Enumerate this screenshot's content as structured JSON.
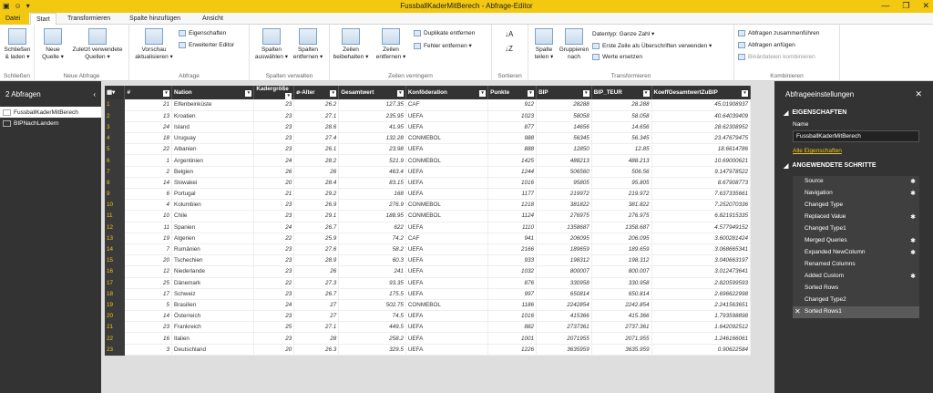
{
  "window": {
    "title": "FussballKaderMitBerech - Abfrage-Editor",
    "controls": [
      "—",
      "❐",
      "✕"
    ]
  },
  "tabs": [
    "Datei",
    "Start",
    "Transformieren",
    "Spalte hinzufügen",
    "Ansicht"
  ],
  "ribbon": {
    "schliessen": {
      "btn": "Schließen\n& laden ▾",
      "label": "Schließen"
    },
    "neue": {
      "b1": "Neue\nQuelle ▾",
      "b2": "Zuletzt verwendete\nQuellen ▾",
      "label": "Neue Abfrage"
    },
    "abfrage": {
      "b1": "Vorschau\naktualisieren ▾",
      "s1": "Eigenschaften",
      "s2": "Erweiterter Editor",
      "label": "Abfrage"
    },
    "spalten": {
      "b1": "Spalten\nauswählen ▾",
      "b2": "Spalten\nentfernen ▾",
      "label": "Spalten verwalten"
    },
    "zeilen": {
      "b1": "Zeilen\nbeibehalten ▾",
      "b2": "Zeilen\nentfernen ▾",
      "s1": "Duplikate entfernen",
      "s2": "Fehler entfernen ▾",
      "label": "Zeilen verringern"
    },
    "sort": {
      "label": "Sortieren"
    },
    "trans": {
      "b1": "Spalte\nteilen ▾",
      "b2": "Gruppieren\nnach",
      "s1": "Datentyp: Ganze Zahl ▾",
      "s2": "Erste Zeile als Überschriften verwenden ▾",
      "s3": "Werte ersetzen",
      "label": "Transformieren"
    },
    "komb": {
      "s1": "Abfragen zusammenführen",
      "s2": "Abfragen anfügen",
      "s3": "Binärdateien kombinieren",
      "label": "Kombinieren"
    }
  },
  "left": {
    "header": "2 Abfragen",
    "queries": [
      "FussballKaderMitBerech",
      "BIPNachLandern"
    ]
  },
  "grid": {
    "columns": [
      "#",
      "Nation",
      "Kadergröße",
      "ø-Alter",
      "Gesamtwert",
      "Konföderation",
      "Punkte",
      "BIP",
      "BIP_TEUR",
      "KoeffGesamtwertZuBIP"
    ],
    "rows": [
      [
        "21",
        "Elfenbeinküste",
        "23",
        "26.2",
        "127.35",
        "CAF",
        "912",
        "28288",
        "28.288",
        "45.01908937"
      ],
      [
        "13",
        "Kroatien",
        "23",
        "27.1",
        "235.95",
        "UEFA",
        "1023",
        "58058",
        "58.058",
        "40.64039409"
      ],
      [
        "24",
        "Island",
        "23",
        "28.6",
        "41.95",
        "UEFA",
        "877",
        "14656",
        "14.656",
        "28.62308952"
      ],
      [
        "18",
        "Uruguay",
        "23",
        "27.4",
        "132.28",
        "CONMEBOL",
        "988",
        "56345",
        "56.345",
        "23.47679475"
      ],
      [
        "22",
        "Albanien",
        "23",
        "26.1",
        "23.98",
        "UEFA",
        "888",
        "12850",
        "12.85",
        "18.6614786"
      ],
      [
        "1",
        "Argentinien",
        "24",
        "28.2",
        "521.9",
        "CONMEBOL",
        "1425",
        "488213",
        "488.213",
        "10.69000621"
      ],
      [
        "2",
        "Belgien",
        "26",
        "26",
        "463.4",
        "UEFA",
        "1244",
        "506560",
        "506.56",
        "9.147978522"
      ],
      [
        "14",
        "Slowakei",
        "20",
        "28.4",
        "83.15",
        "UEFA",
        "1016",
        "95805",
        "95.805",
        "8.67908773"
      ],
      [
        "6",
        "Portugal",
        "21",
        "29.2",
        "168",
        "UEFA",
        "1177",
        "219972",
        "219.972",
        "7.637335661"
      ],
      [
        "4",
        "Kolumbien",
        "23",
        "26.9",
        "276.9",
        "CONMEBOL",
        "1218",
        "381822",
        "381.822",
        "7.252070336"
      ],
      [
        "10",
        "Chile",
        "23",
        "29.1",
        "188.95",
        "CONMEBOL",
        "1124",
        "276975",
        "276.975",
        "6.821915335"
      ],
      [
        "11",
        "Spanien",
        "24",
        "26.7",
        "622",
        "UEFA",
        "1110",
        "1358687",
        "1358.687",
        "4.577949152"
      ],
      [
        "19",
        "Algerien",
        "22",
        "25.9",
        "74.2",
        "CAF",
        "941",
        "206095",
        "206.095",
        "3.600281424"
      ],
      [
        "7",
        "Rumänien",
        "23",
        "27.6",
        "58.2",
        "UEFA",
        "2166",
        "189659",
        "189.659",
        "3.068665341"
      ],
      [
        "20",
        "Tschechien",
        "23",
        "28.9",
        "60.3",
        "UEFA",
        "933",
        "198312",
        "198.312",
        "3.040663197"
      ],
      [
        "12",
        "Niederlande",
        "23",
        "26",
        "241",
        "UEFA",
        "1032",
        "800007",
        "800.007",
        "3.012473641"
      ],
      [
        "25",
        "Dänemark",
        "22",
        "27.3",
        "93.35",
        "UEFA",
        "876",
        "330958",
        "330.958",
        "2.820599593"
      ],
      [
        "17",
        "Schweiz",
        "23",
        "26.7",
        "175.5",
        "UEFA",
        "997",
        "650814",
        "650.814",
        "2.696622998"
      ],
      [
        "5",
        "Brasilien",
        "24",
        "27",
        "502.75",
        "CONMEBOL",
        "1186",
        "2242854",
        "2242.854",
        "2.241563651"
      ],
      [
        "14",
        "Österreich",
        "23",
        "27",
        "74.5",
        "UEFA",
        "1016",
        "415366",
        "415.366",
        "1.793598898"
      ],
      [
        "23",
        "Frankreich",
        "25",
        "27.1",
        "449.5",
        "UEFA",
        "882",
        "2737361",
        "2737.361",
        "1.642092512"
      ],
      [
        "16",
        "Italien",
        "23",
        "28",
        "258.2",
        "UEFA",
        "1001",
        "2071955",
        "2071.955",
        "1.246166061"
      ],
      [
        "3",
        "Deutschland",
        "20",
        "26.3",
        "329.5",
        "UEFA",
        "1226",
        "3635959",
        "3635.959",
        "0.90622584"
      ]
    ]
  },
  "right": {
    "header": "Abfrageeinstellungen",
    "props": "EIGENSCHAFTEN",
    "name_label": "Name",
    "name_value": "FussballKaderMitBerech",
    "all_props": "Alle Eigenschaften",
    "steps_header": "ANGEWENDETE SCHRITTE",
    "steps": [
      {
        "n": "Source",
        "g": true
      },
      {
        "n": "Navigation",
        "g": true
      },
      {
        "n": "Changed Type",
        "g": false
      },
      {
        "n": "Replaced Value",
        "g": true
      },
      {
        "n": "Changed Type1",
        "g": false
      },
      {
        "n": "Merged Queries",
        "g": true
      },
      {
        "n": "Expanded NewColumn",
        "g": true
      },
      {
        "n": "Renamed Columns",
        "g": false
      },
      {
        "n": "Added Custom",
        "g": true
      },
      {
        "n": "Sorted Rows",
        "g": false
      },
      {
        "n": "Changed Type2",
        "g": false
      },
      {
        "n": "Sorted Rows1",
        "g": false
      }
    ]
  }
}
